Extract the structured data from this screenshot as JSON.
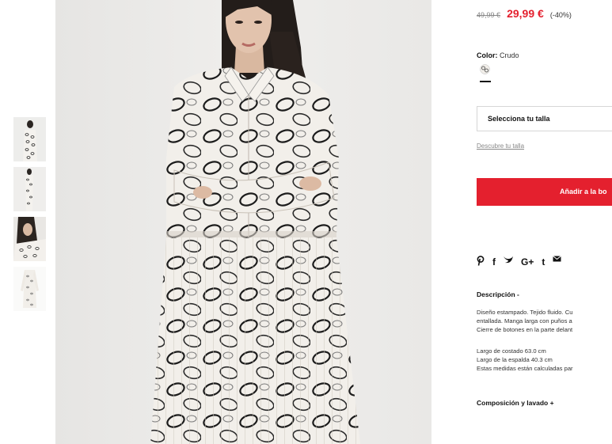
{
  "product": {
    "price_old": "49,99 €",
    "price_new": "29,99 €",
    "discount": "(-40%)"
  },
  "color": {
    "label": "Color:",
    "value": "Crudo"
  },
  "size": {
    "select_placeholder": "Selecciona tu talla",
    "guide_link": "Descubre tu talla"
  },
  "cart": {
    "add_label": "Añadir a la bo"
  },
  "share": {
    "icons": [
      "pinterest-icon",
      "facebook-icon",
      "twitter-icon",
      "google-plus-icon",
      "tumblr-icon",
      "email-icon"
    ],
    "labels": [
      "P",
      "f",
      "y",
      "G+",
      "t",
      "✉"
    ]
  },
  "description": {
    "title": "Descripción -",
    "lines": [
      "Diseño estampado. Tejido fluido. Cu",
      "entallada. Manga larga con puños a",
      "Cierre de botones en la parte delant"
    ],
    "measures": [
      "Largo de costado 63.0 cm",
      "Largo de la espalda 40.3 cm",
      "Estas medidas están calculadas par"
    ]
  },
  "composition": {
    "title": "Composición y lavado +"
  },
  "colors": {
    "accent": "#e4202e",
    "text": "#111111",
    "muted": "#888888"
  }
}
